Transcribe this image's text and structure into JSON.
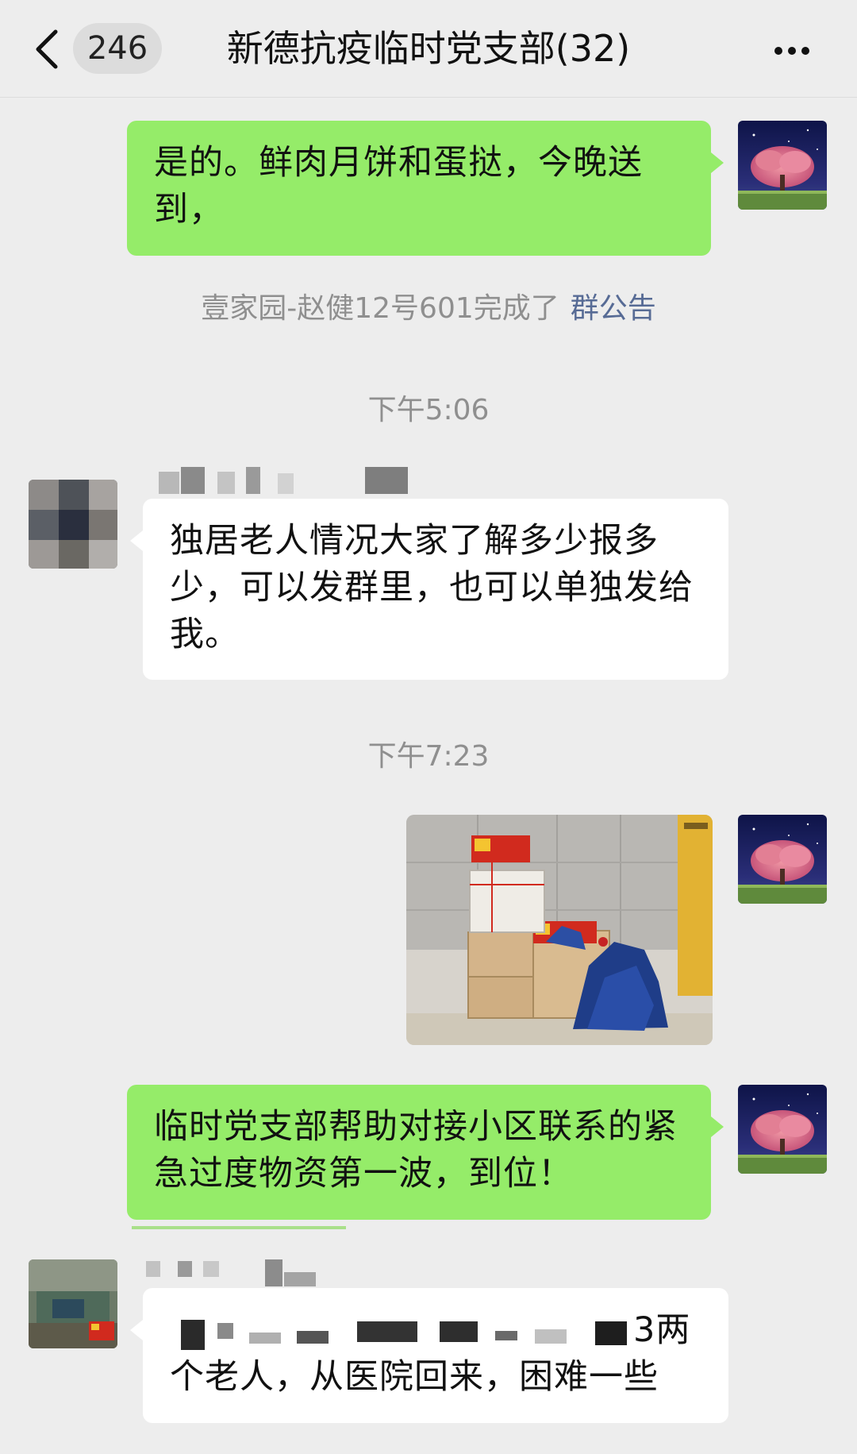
{
  "header": {
    "unread_count": "246",
    "title": "新德抗疫临时党支部(32)"
  },
  "messages": {
    "m1": {
      "text": "是的。鲜肉月饼和蛋挞，今晚送到，"
    },
    "notice": {
      "text": "壹家园-赵健12号601完成了",
      "link": "群公告"
    },
    "time1": "下午5:06",
    "m2": {
      "text": "独居老人情况大家了解多少报多少，可以发群里，也可以单独发给我。"
    },
    "time2": "下午7:23",
    "m4": {
      "text": "临时党支部帮助对接小区联系的紧急过度物资第一波，到位！"
    },
    "m5": {
      "line1_visible": "3两",
      "line2": "个老人，从医院回来，困难一些"
    }
  },
  "icons": {
    "back": "chevron-left-icon",
    "more": "more-dots-icon",
    "flag": "party-flag-icon"
  },
  "colors": {
    "background": "#ededed",
    "outgoing_bubble": "#95ec69",
    "incoming_bubble": "#ffffff",
    "link": "#576b95",
    "system_text": "#8f8f8f"
  }
}
